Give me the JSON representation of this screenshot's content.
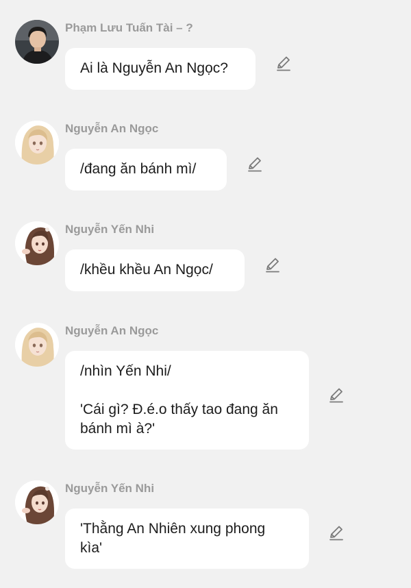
{
  "messages": [
    {
      "sender": "Phạm Lưu Tuấn Tài – ?",
      "lines": [
        "Ai là Nguyễn An Ngọc?"
      ],
      "avatar_icon": "male-portrait-avatar"
    },
    {
      "sender": "Nguyễn An Ngọc",
      "lines": [
        "/đang ăn bánh mì/"
      ],
      "avatar_icon": "blonde-girl-avatar"
    },
    {
      "sender": "Nguyễn Yến Nhi",
      "lines": [
        "/khều khều An Ngọc/"
      ],
      "avatar_icon": "brunette-girl-avatar"
    },
    {
      "sender": "Nguyễn An Ngọc",
      "lines": [
        "/nhìn Yến Nhi/",
        "",
        "'Cái gì? Đ.é.o thấy tao đang ăn",
        "bánh mì à?'"
      ],
      "avatar_icon": "blonde-girl-avatar"
    },
    {
      "sender": "Nguyễn Yến Nhi",
      "lines": [
        "'Thằng An Nhiên xung phong",
        "kìa'"
      ],
      "avatar_icon": "brunette-girl-avatar"
    }
  ],
  "icons": {
    "edit": "pencil-edit-icon"
  },
  "colors": {
    "background": "#f1f1f1",
    "bubble": "#ffffff",
    "sender_name": "#9a9a9a",
    "message_text": "#1c1c1c",
    "edit_icon": "#7a7a7a"
  }
}
